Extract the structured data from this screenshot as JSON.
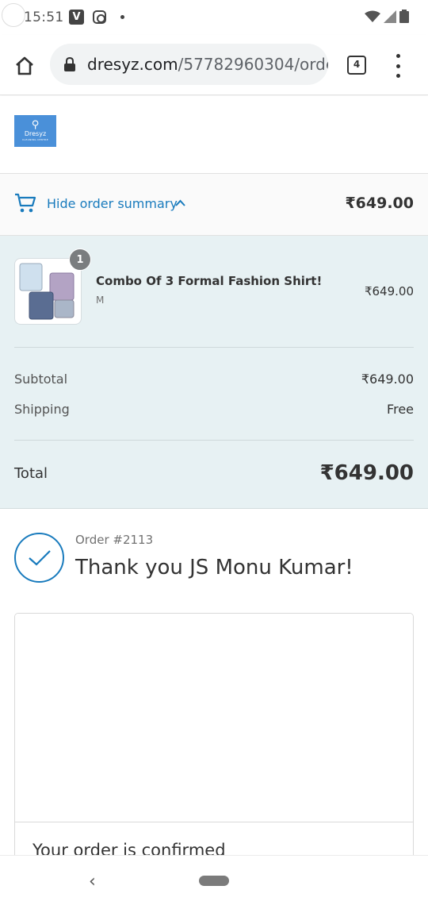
{
  "status_bar": {
    "time": "15:51",
    "icons": [
      "vimeo-icon",
      "instagram-icon",
      "notification-dot-icon",
      "wifi-icon",
      "signal-icon",
      "battery-icon"
    ]
  },
  "browser": {
    "url_domain": "dresyz.com",
    "url_path": "/57782960304/orde",
    "tab_count": "4",
    "icons": [
      "home-icon",
      "lock-icon",
      "tabs-icon",
      "more-vert-icon"
    ]
  },
  "store": {
    "logo_text": "Dresyz",
    "logo_tagline": "CLEANING CENTRE"
  },
  "summary_toggle": {
    "label": "Hide order summary",
    "total": "₹649.00"
  },
  "order_summary": {
    "item": {
      "quantity": "1",
      "name": "Combo Of 3 Formal Fashion Shirt!",
      "variant": "M",
      "price": "₹649.00"
    },
    "subtotal_label": "Subtotal",
    "subtotal_value": "₹649.00",
    "shipping_label": "Shipping",
    "shipping_value": "Free",
    "total_label": "Total",
    "total_value": "₹649.00"
  },
  "confirmation": {
    "order_number": "Order #2113",
    "thank_you": "Thank you JS Monu Kumar!",
    "card_title": "Your order is confirmed"
  },
  "colors": {
    "accent": "#197bbd",
    "summary_bg": "#e7f1f3",
    "logo_bg": "#4a90d9"
  }
}
